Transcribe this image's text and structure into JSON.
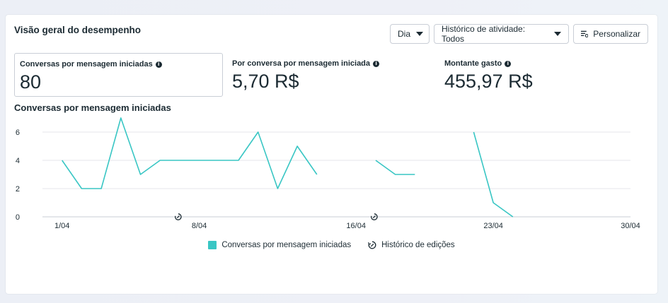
{
  "header": {
    "title": "Visão geral do desempenho"
  },
  "toolbar": {
    "period_label": "Dia",
    "history_label": "Histórico de atividade: Todos",
    "customize_label": "Personalizar"
  },
  "metrics": [
    {
      "label": "Conversas por mensagem iniciadas",
      "value": "80"
    },
    {
      "label": "Por conversa por mensagem iniciada",
      "value": "5,70 R$"
    },
    {
      "label": "Montante gasto",
      "value": "455,97 R$"
    }
  ],
  "chart_title": "Conversas por mensagem iniciadas",
  "colors": {
    "series": "#39c6c4",
    "grid": "#e4e6eb",
    "axis": "#c9ced6"
  },
  "chart_data": {
    "type": "line",
    "title": "Conversas por mensagem iniciadas",
    "x_ticks": [
      "1/04",
      "8/04",
      "16/04",
      "23/04",
      "30/04"
    ],
    "y_ticks": [
      0,
      2,
      4,
      6
    ],
    "ylim": [
      0,
      7.3
    ],
    "grid": true,
    "series": [
      {
        "name": "Conversas por mensagem iniciadas",
        "points": [
          {
            "date": "1/04",
            "value": 4
          },
          {
            "date": "2/04",
            "value": 2
          },
          {
            "date": "3/04",
            "value": 2
          },
          {
            "date": "4/04",
            "value": 7
          },
          {
            "date": "5/04",
            "value": 3
          },
          {
            "date": "6/04",
            "value": 4
          },
          {
            "date": "7/04",
            "value": 4
          },
          {
            "date": "8/04",
            "value": 4
          },
          {
            "date": "9/04",
            "value": 4
          },
          {
            "date": "10/04",
            "value": 4
          },
          {
            "date": "11/04",
            "value": 6
          },
          {
            "date": "12/04",
            "value": 2
          },
          {
            "date": "13/04",
            "value": 5
          },
          {
            "date": "14/04",
            "value": 3
          },
          {
            "date": "17/04",
            "value": 4
          },
          {
            "date": "18/04",
            "value": 3
          },
          {
            "date": "19/04",
            "value": 3
          },
          {
            "date": "22/04",
            "value": 6
          },
          {
            "date": "23/04",
            "value": 1
          },
          {
            "date": "24/04",
            "value": 0
          }
        ]
      }
    ],
    "edit_markers": [
      "7/04",
      "17/04"
    ],
    "legend": [
      "Conversas por mensagem iniciadas",
      "Histórico de edições"
    ]
  }
}
